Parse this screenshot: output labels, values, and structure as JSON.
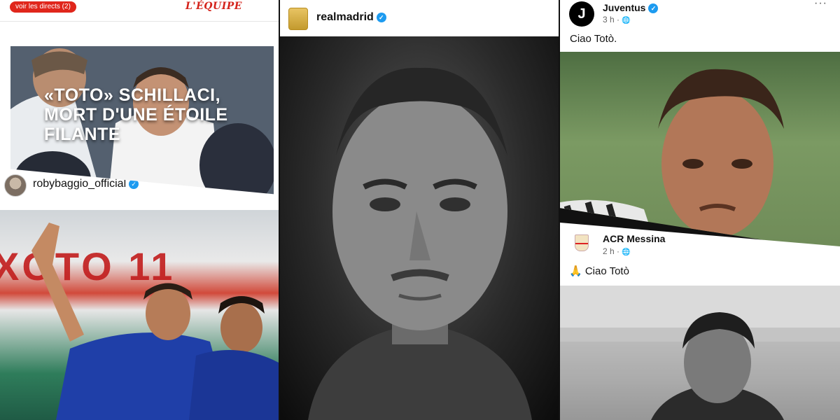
{
  "lequipe": {
    "live_pill": "voir les directs (2)",
    "logo": "L'ÉQUIPE",
    "headline_line1": "«TOTO» SCHILLACI,",
    "headline_line2": "MORT D'UNE ÉTOILE",
    "headline_line3": "FILANTE"
  },
  "baggio": {
    "username": "robybaggio_official",
    "verified": "✓",
    "banner_text": "XOTO 11"
  },
  "realmadrid": {
    "username": "realmadrid",
    "verified": "✓"
  },
  "juventus": {
    "logo_letter": "J",
    "name": "Juventus",
    "verified": "✓",
    "time": "3 h ·",
    "globe": "🌐",
    "more": "···",
    "caption": "Ciao Totò."
  },
  "messina": {
    "name": "ACR Messina",
    "time": "2 h ·",
    "globe": "🌐",
    "caption": "🙏 Ciao Totò"
  }
}
